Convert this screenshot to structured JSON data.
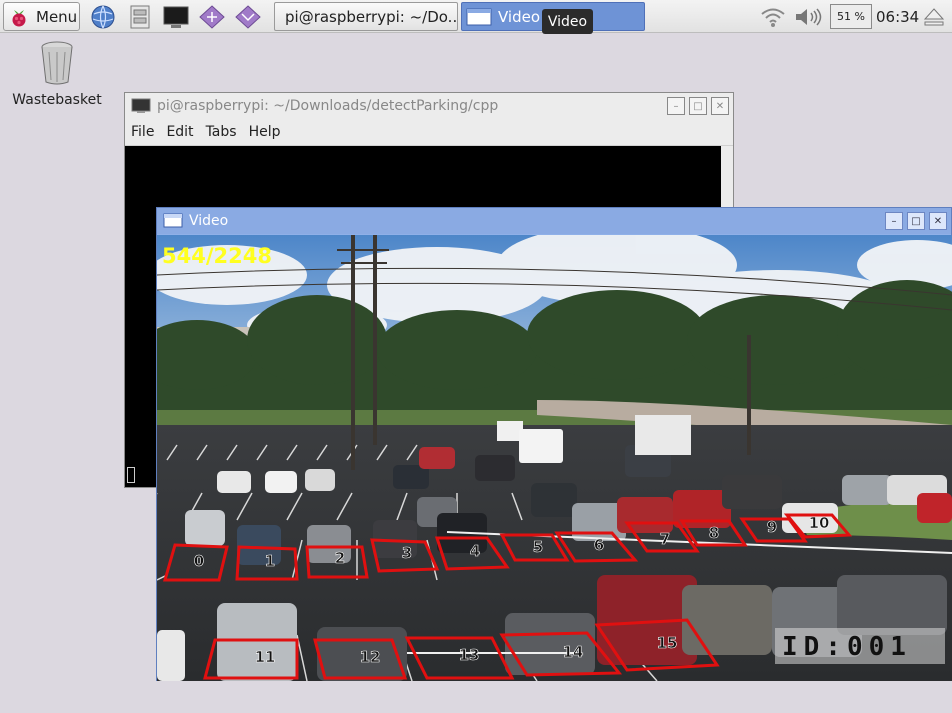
{
  "taskbar": {
    "menu_label": "Menu",
    "launchers": [
      "browser-icon",
      "file-manager-icon",
      "terminal-icon",
      "math-icon",
      "wolfram-icon"
    ],
    "windows": [
      {
        "label": "pi@raspberrypi: ~/Do...",
        "active": false
      },
      {
        "label": "Video",
        "active": true
      }
    ],
    "tooltip": "Video",
    "tray": {
      "cpu": "51 %",
      "time": "06:34"
    }
  },
  "desktop": {
    "wastebasket_label": "Wastebasket"
  },
  "terminal": {
    "title": "pi@raspberrypi: ~/Downloads/detectParking/cpp",
    "menu": [
      "File",
      "Edit",
      "Tabs",
      "Help"
    ]
  },
  "video": {
    "title": "Video",
    "frame_counter": "544/2248",
    "camera_id": "ID:001",
    "spot_labels": [
      "0",
      "1",
      "2",
      "3",
      "4",
      "5",
      "6",
      "7",
      "8",
      "9",
      "10",
      "11",
      "12",
      "13",
      "14",
      "15"
    ]
  },
  "colors": {
    "accent": "#6e93d6",
    "spot_outline": "#e01010",
    "counter_text": "#ffff20"
  }
}
